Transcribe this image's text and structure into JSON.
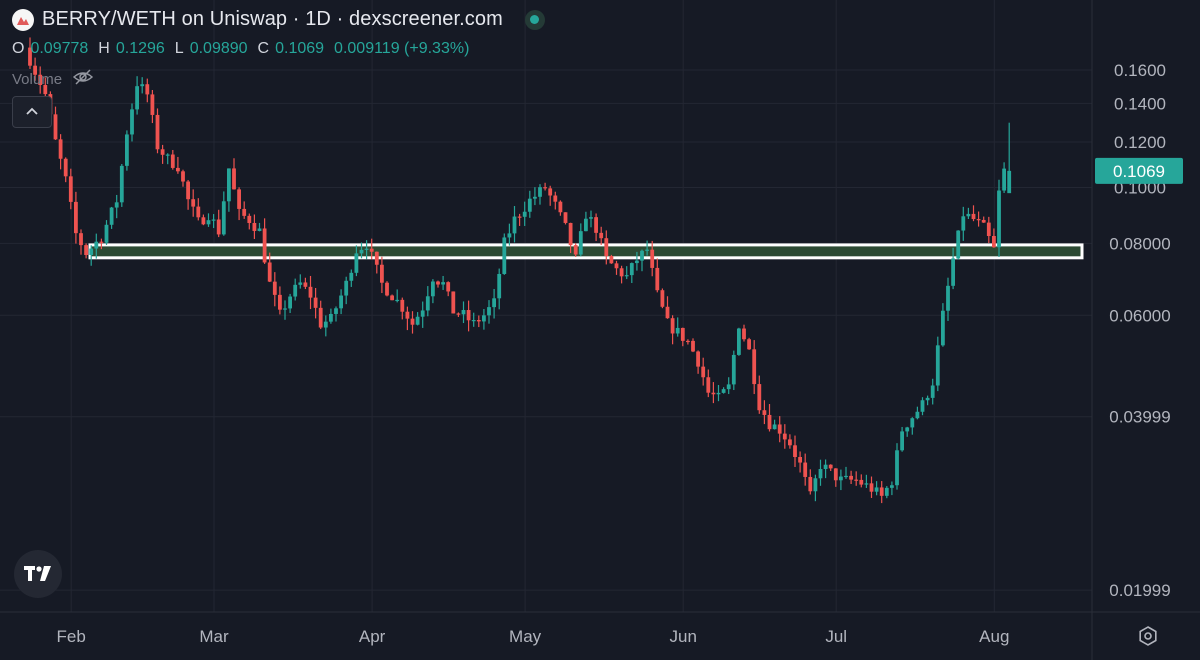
{
  "header": {
    "title": "BERRY/WETH on Uniswap · 1D · dexscreener.com"
  },
  "ohlc": {
    "open_label": "O",
    "open_value": "0.09778",
    "high_label": "H",
    "high_value": "0.1296",
    "low_label": "L",
    "low_value": "0.09890",
    "close_label": "C",
    "close_value": "0.1069",
    "change": "0.009119 (+9.33%)"
  },
  "volume_label": "Volume",
  "icons": {
    "logo": "dexscreener-berry-logo",
    "status": "live-status-dot",
    "eye": "eye-slash-icon",
    "collapse": "chevron-up-icon",
    "brand": "tradingview-logo",
    "settings": "gear-icon"
  },
  "colors": {
    "background": "#161a25",
    "up": "#26a69a",
    "down": "#ef5350",
    "zone_fill": "#2c4a33",
    "zone_border": "#ffffff",
    "grid": "#232733",
    "axis_text": "#b2b5be"
  },
  "chart_data": {
    "type": "candlestick",
    "title": "BERRY/WETH on Uniswap · 1D · dexscreener.com",
    "y_axis": {
      "scale": "log",
      "position": "right",
      "ylim": [
        0.0175,
        0.175
      ],
      "tick_labels": [
        "0.1600",
        "0.1400",
        "0.1200",
        "0.1000",
        "0.08000",
        "0.06000",
        "0.03999",
        "0.01999"
      ]
    },
    "x_axis": {
      "tick_labels": [
        "Feb",
        "Mar",
        "Apr",
        "May",
        "Jun",
        "Jul",
        "Aug"
      ]
    },
    "grid": true,
    "last_price_label": "0.1069",
    "zone": {
      "low": 0.0755,
      "high": 0.0795
    },
    "anchors": [
      {
        "d": 0,
        "p": 0.175
      },
      {
        "d": 4,
        "p": 0.145
      },
      {
        "d": 6,
        "p": 0.12
      },
      {
        "d": 8,
        "p": 0.103
      },
      {
        "d": 10,
        "p": 0.083
      },
      {
        "d": 12,
        "p": 0.077
      },
      {
        "d": 15,
        "p": 0.082
      },
      {
        "d": 18,
        "p": 0.095
      },
      {
        "d": 20,
        "p": 0.125
      },
      {
        "d": 22,
        "p": 0.152
      },
      {
        "d": 24,
        "p": 0.145
      },
      {
        "d": 26,
        "p": 0.118
      },
      {
        "d": 28,
        "p": 0.112
      },
      {
        "d": 30,
        "p": 0.109
      },
      {
        "d": 32,
        "p": 0.095
      },
      {
        "d": 34,
        "p": 0.087
      },
      {
        "d": 36,
        "p": 0.09
      },
      {
        "d": 38,
        "p": 0.084
      },
      {
        "d": 40,
        "p": 0.108
      },
      {
        "d": 42,
        "p": 0.09
      },
      {
        "d": 44,
        "p": 0.088
      },
      {
        "d": 46,
        "p": 0.084
      },
      {
        "d": 48,
        "p": 0.068
      },
      {
        "d": 50,
        "p": 0.06
      },
      {
        "d": 52,
        "p": 0.065
      },
      {
        "d": 54,
        "p": 0.068
      },
      {
        "d": 56,
        "p": 0.065
      },
      {
        "d": 58,
        "p": 0.058
      },
      {
        "d": 60,
        "p": 0.059
      },
      {
        "d": 63,
        "p": 0.068
      },
      {
        "d": 65,
        "p": 0.078
      },
      {
        "d": 67,
        "p": 0.08
      },
      {
        "d": 70,
        "p": 0.068
      },
      {
        "d": 72,
        "p": 0.065
      },
      {
        "d": 74,
        "p": 0.062
      },
      {
        "d": 76,
        "p": 0.058
      },
      {
        "d": 78,
        "p": 0.062
      },
      {
        "d": 80,
        "p": 0.07
      },
      {
        "d": 82,
        "p": 0.068
      },
      {
        "d": 84,
        "p": 0.061
      },
      {
        "d": 86,
        "p": 0.06
      },
      {
        "d": 88,
        "p": 0.058
      },
      {
        "d": 90,
        "p": 0.06
      },
      {
        "d": 92,
        "p": 0.063
      },
      {
        "d": 94,
        "p": 0.08
      },
      {
        "d": 96,
        "p": 0.088
      },
      {
        "d": 99,
        "p": 0.095
      },
      {
        "d": 102,
        "p": 0.1
      },
      {
        "d": 104,
        "p": 0.093
      },
      {
        "d": 106,
        "p": 0.085
      },
      {
        "d": 108,
        "p": 0.075
      },
      {
        "d": 110,
        "p": 0.09
      },
      {
        "d": 112,
        "p": 0.085
      },
      {
        "d": 114,
        "p": 0.075
      },
      {
        "d": 116,
        "p": 0.072
      },
      {
        "d": 118,
        "p": 0.07
      },
      {
        "d": 120,
        "p": 0.075
      },
      {
        "d": 122,
        "p": 0.078
      },
      {
        "d": 124,
        "p": 0.065
      },
      {
        "d": 126,
        "p": 0.058
      },
      {
        "d": 128,
        "p": 0.056
      },
      {
        "d": 130,
        "p": 0.054
      },
      {
        "d": 132,
        "p": 0.05
      },
      {
        "d": 134,
        "p": 0.044
      },
      {
        "d": 136,
        "p": 0.043
      },
      {
        "d": 138,
        "p": 0.045
      },
      {
        "d": 140,
        "p": 0.058
      },
      {
        "d": 142,
        "p": 0.052
      },
      {
        "d": 144,
        "p": 0.042
      },
      {
        "d": 146,
        "p": 0.039
      },
      {
        "d": 148,
        "p": 0.038
      },
      {
        "d": 150,
        "p": 0.036
      },
      {
        "d": 152,
        "p": 0.033
      },
      {
        "d": 154,
        "p": 0.029
      },
      {
        "d": 156,
        "p": 0.033
      },
      {
        "d": 158,
        "p": 0.032
      },
      {
        "d": 160,
        "p": 0.031
      },
      {
        "d": 163,
        "p": 0.031
      },
      {
        "d": 166,
        "p": 0.03
      },
      {
        "d": 168,
        "p": 0.029
      },
      {
        "d": 170,
        "p": 0.031
      },
      {
        "d": 172,
        "p": 0.038
      },
      {
        "d": 174,
        "p": 0.04
      },
      {
        "d": 176,
        "p": 0.042
      },
      {
        "d": 178,
        "p": 0.046
      },
      {
        "d": 180,
        "p": 0.06
      },
      {
        "d": 182,
        "p": 0.075
      },
      {
        "d": 184,
        "p": 0.09
      },
      {
        "d": 186,
        "p": 0.088
      },
      {
        "d": 188,
        "p": 0.085
      },
      {
        "d": 190,
        "p": 0.078
      },
      {
        "d": 191,
        "p": 0.0978
      },
      {
        "d": 192,
        "p": 0.1069
      }
    ],
    "last_candle": {
      "open": 0.09778,
      "high": 0.1296,
      "low": 0.0989,
      "close": 0.1069
    }
  }
}
